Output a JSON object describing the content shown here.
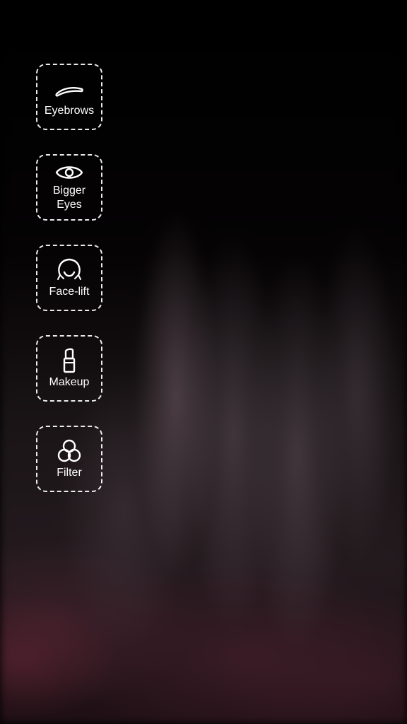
{
  "camera": {
    "description_hidden": ""
  },
  "toolbar": {
    "items": [
      {
        "id": "eyebrows",
        "label": "Eyebrows",
        "icon": "eyebrow-icon"
      },
      {
        "id": "bigger-eyes",
        "label_line1": "Bigger",
        "label_line2": "Eyes",
        "icon": "eye-icon"
      },
      {
        "id": "face-lift",
        "label": "Face-lift",
        "icon": "face-lift-icon"
      },
      {
        "id": "makeup",
        "label": "Makeup",
        "icon": "lipstick-icon"
      },
      {
        "id": "filter",
        "label": "Filter",
        "icon": "filter-circles-icon"
      }
    ]
  },
  "colors": {
    "background": "#000000",
    "foreground": "#ffffff"
  }
}
